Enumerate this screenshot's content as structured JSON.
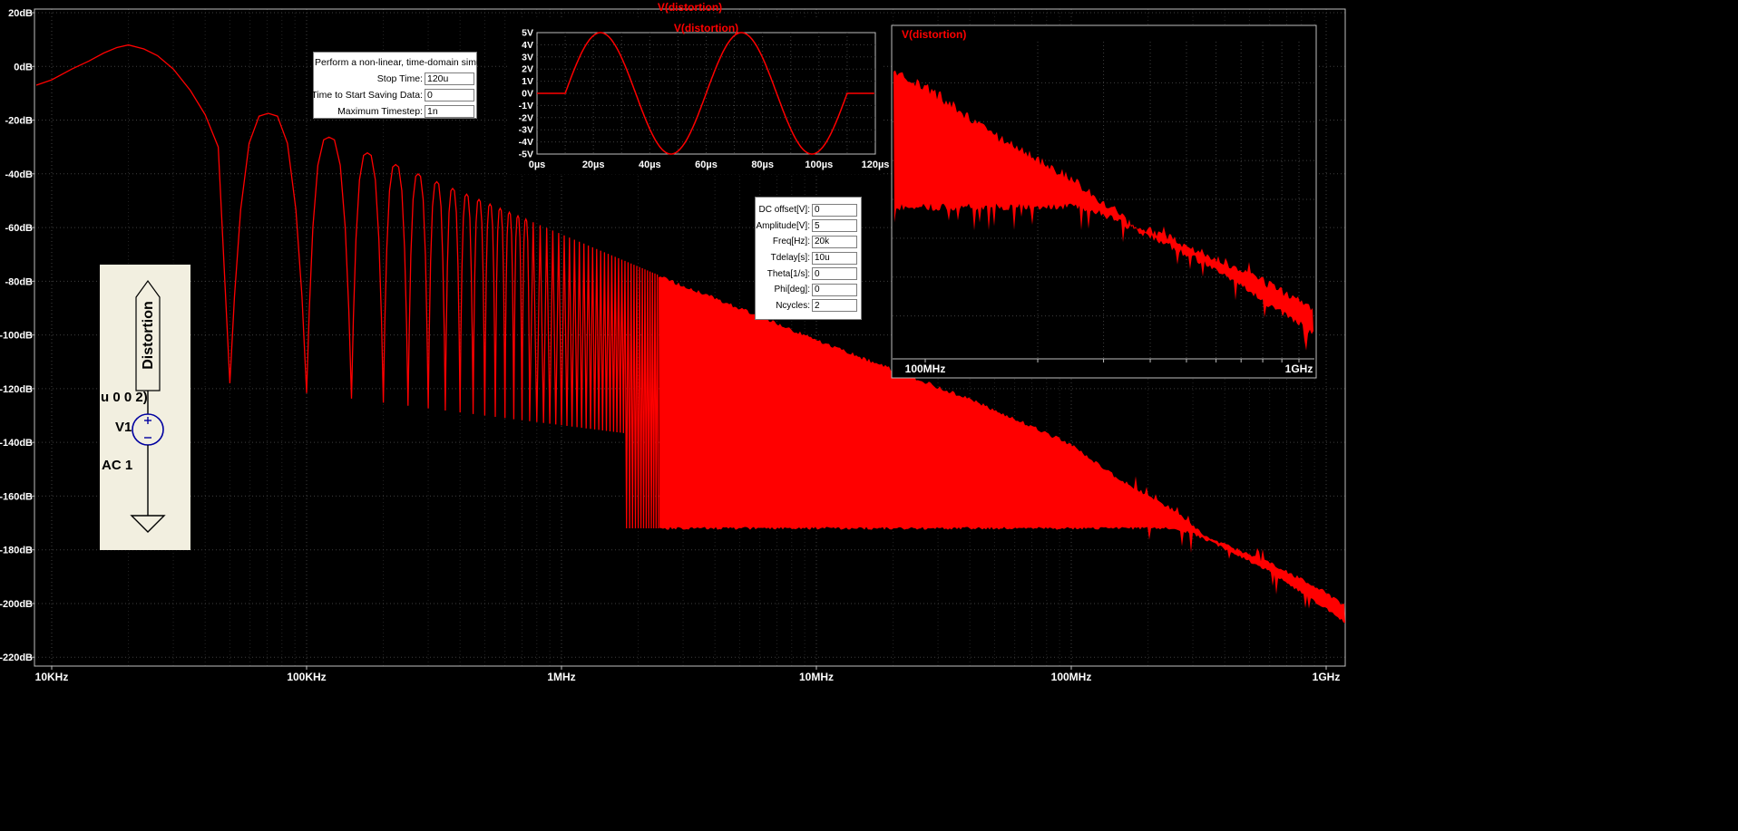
{
  "colors": {
    "trace": "#ff0000",
    "background": "#000000",
    "grid_major": "#3f3f3f",
    "grid_minor": "#242424",
    "axis": "#bebebe",
    "tick_label": "#ffffff",
    "plot_title": "#ff0000",
    "dialog_bg": "#ffffff",
    "schematic_bg": "#f2efe0",
    "schematic_symbol": "#0000a0",
    "net_label_red": "#e60000"
  },
  "chart_data": [
    {
      "id": "main-spectrum",
      "type": "line",
      "title": "V(distortion)",
      "x_scale": "log",
      "x_unit": "Hz",
      "y_unit": "dB",
      "x_ticks": [
        {
          "f": 10000,
          "label": "10KHz"
        },
        {
          "f": 100000,
          "label": "100KHz"
        },
        {
          "f": 1000000,
          "label": "1MHz"
        },
        {
          "f": 10000000,
          "label": "10MHz"
        },
        {
          "f": 100000000,
          "label": "100MHz"
        },
        {
          "f": 1000000000,
          "label": "1GHz"
        }
      ],
      "y_ticks": [
        {
          "db": 20,
          "label": "20dB"
        },
        {
          "db": 0,
          "label": "0dB"
        },
        {
          "db": -20,
          "label": "-20dB"
        },
        {
          "db": -40,
          "label": "-40dB"
        },
        {
          "db": -60,
          "label": "-60dB"
        },
        {
          "db": -80,
          "label": "-80dB"
        },
        {
          "db": -100,
          "label": "-100dB"
        },
        {
          "db": -120,
          "label": "-120dB"
        },
        {
          "db": -140,
          "label": "-140dB"
        },
        {
          "db": -160,
          "label": "-160dB"
        },
        {
          "db": -180,
          "label": "-180dB"
        },
        {
          "db": -200,
          "label": "-200dB"
        },
        {
          "db": -220,
          "label": "-220dB"
        }
      ],
      "main_lobe": [
        [
          8700,
          -7
        ],
        [
          10000,
          -5
        ],
        [
          12000,
          -1
        ],
        [
          14000,
          2
        ],
        [
          16000,
          5
        ],
        [
          18000,
          7
        ],
        [
          20000,
          8
        ],
        [
          23000,
          6.5
        ],
        [
          26000,
          4
        ],
        [
          30000,
          -1
        ],
        [
          35000,
          -9
        ],
        [
          40000,
          -18
        ],
        [
          45000,
          -30
        ]
      ],
      "nulls_hz": {
        "start": 50000,
        "step": 50000,
        "end": 2400000
      },
      "lobe_peak_envelope": {
        "ref_hz": 73000,
        "ref_db": -17,
        "slope_db_per_decade": -40
      },
      "null_depth": {
        "ref_hz": 50000,
        "base_db": -118,
        "slope_db_per_decade": -12,
        "deep_after_hz": 1800000,
        "deep_db": -172
      },
      "noise_band_top": [
        [
          2400000,
          -78
        ],
        [
          5000000,
          -90
        ],
        [
          10000000,
          -102
        ],
        [
          20000000,
          -113
        ],
        [
          40000000,
          -124
        ],
        [
          70000000,
          -134
        ],
        [
          100000000,
          -141
        ],
        [
          150000000,
          -153
        ],
        [
          250000000,
          -165
        ],
        [
          350000000,
          -176
        ],
        [
          450000000,
          -180
        ],
        [
          600000000,
          -185
        ],
        [
          800000000,
          -191
        ],
        [
          1000000000,
          -196
        ],
        [
          1180000000,
          -201
        ]
      ],
      "noise_band_bottom": [
        [
          2400000,
          -172
        ],
        [
          250000000,
          -172
        ],
        [
          300000000,
          -174
        ],
        [
          450000000,
          -182
        ],
        [
          600000000,
          -188
        ],
        [
          800000000,
          -196
        ],
        [
          1000000000,
          -202
        ],
        [
          1180000000,
          -207
        ]
      ]
    },
    {
      "id": "time-domain",
      "type": "line",
      "title": "V(distortion)",
      "x_unit": "s",
      "y_unit": "V",
      "x_ticks": [
        {
          "t": 0,
          "label": "0µs"
        },
        {
          "t": 20,
          "label": "20µs"
        },
        {
          "t": 40,
          "label": "40µs"
        },
        {
          "t": 60,
          "label": "60µs"
        },
        {
          "t": 80,
          "label": "80µs"
        },
        {
          "t": 100,
          "label": "100µs"
        },
        {
          "t": 120,
          "label": "120µs"
        }
      ],
      "y_ticks": [
        {
          "v": 5,
          "label": "5V"
        },
        {
          "v": 4,
          "label": "4V"
        },
        {
          "v": 3,
          "label": "3V"
        },
        {
          "v": 2,
          "label": "2V"
        },
        {
          "v": 1,
          "label": "1V"
        },
        {
          "v": 0,
          "label": "0V"
        },
        {
          "v": -1,
          "label": "-1V"
        },
        {
          "v": -2,
          "label": "-2V"
        },
        {
          "v": -3,
          "label": "-3V"
        },
        {
          "v": -4,
          "label": "-4V"
        },
        {
          "v": -5,
          "label": "-5V"
        }
      ],
      "waveform": {
        "amplitude_v": 5,
        "freq_hz": 20000,
        "tdelay_us": 10,
        "ncycles": 2,
        "t_range_us": [
          0,
          120
        ]
      },
      "key_points": {
        "t_us": [
          0,
          10,
          22.5,
          35,
          47.5,
          60,
          72.5,
          85,
          97.5,
          110,
          120
        ],
        "v": [
          0,
          0,
          5,
          0,
          -5,
          0,
          5,
          0,
          -5,
          0,
          0
        ]
      }
    },
    {
      "id": "zoom-spectrum",
      "type": "line",
      "title": "V(distortion)",
      "x_scale": "log",
      "x_unit": "Hz",
      "y_unit": "dB",
      "x_ticks": [
        {
          "f": 100000000,
          "label": "100MHz"
        },
        {
          "f": 1000000000,
          "label": "1GHz"
        }
      ],
      "x_range_hz": [
        82000000,
        1110000000
      ],
      "y_range_db": [
        -135,
        -210
      ],
      "band_source": "noise band of main-spectrum between 100MHz and 1GHz"
    }
  ],
  "sim_dialog": {
    "heading": "Perform a non-linear, time-domain simulation.",
    "fields": [
      {
        "label": "Stop Time:",
        "value": "120u"
      },
      {
        "label": "Time to Start Saving Data:",
        "value": "0"
      },
      {
        "label": "Maximum Timestep:",
        "value": "1n"
      }
    ]
  },
  "sine_dialog": {
    "fields": [
      {
        "label": "DC offset[V]:",
        "value": "0"
      },
      {
        "label": "Amplitude[V]:",
        "value": "5"
      },
      {
        "label": "Freq[Hz]:",
        "value": "20k"
      },
      {
        "label": "Tdelay[s]:",
        "value": "10u"
      },
      {
        "label": "Theta[1/s]:",
        "value": "0"
      },
      {
        "label": "Phi[deg]:",
        "value": "0"
      },
      {
        "label": "Ncycles:",
        "value": "2"
      }
    ]
  },
  "schematic": {
    "net_label": "Distortion",
    "reference": "V1",
    "value_label": "AC 1",
    "spice_fragment": "u 0 0 2)"
  }
}
